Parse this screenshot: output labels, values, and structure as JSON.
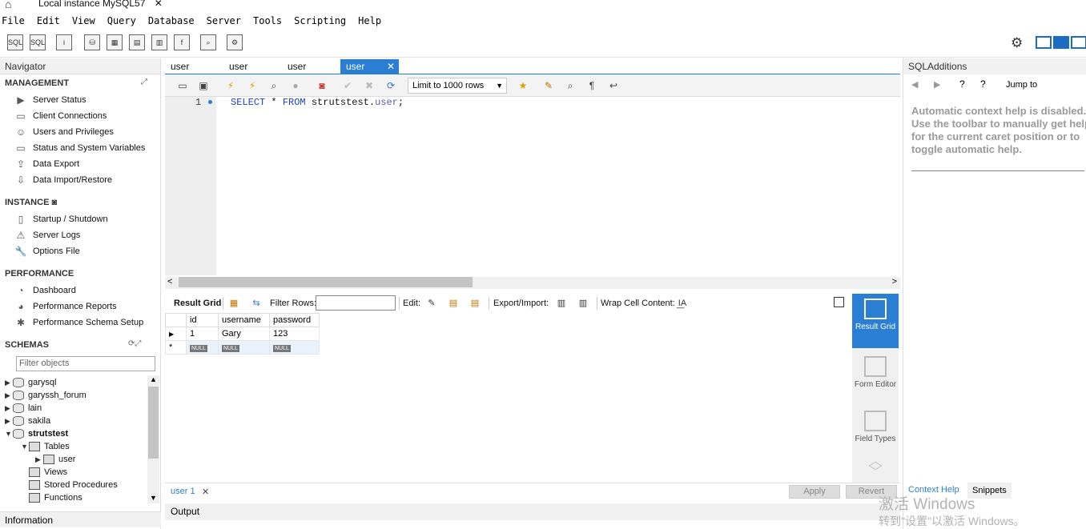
{
  "window": {
    "tab_title": "Local instance MySQL57",
    "tab_close": "✕",
    "home_icon": "home-icon"
  },
  "menu": [
    "File",
    "Edit",
    "View",
    "Query",
    "Database",
    "Server",
    "Tools",
    "Scripting",
    "Help"
  ],
  "navigator": {
    "title": "Navigator",
    "management_header": "MANAGEMENT",
    "management": [
      "Server Status",
      "Client Connections",
      "Users and Privileges",
      "Status and System Variables",
      "Data Export",
      "Data Import/Restore"
    ],
    "instance_header": "INSTANCE",
    "instance": [
      "Startup / Shutdown",
      "Server Logs",
      "Options File"
    ],
    "performance_header": "PERFORMANCE",
    "performance": [
      "Dashboard",
      "Performance Reports",
      "Performance Schema Setup"
    ],
    "schemas_header": "SCHEMAS",
    "filter_placeholder": "Filter objects",
    "schemas": [
      "garysql",
      "garyssh_forum",
      "lain",
      "sakila",
      "strutstest"
    ],
    "tree": {
      "tables": "Tables",
      "table_user": "user",
      "views": "Views",
      "procedures": "Stored Procedures",
      "functions": "Functions"
    },
    "information": "Information"
  },
  "query_tabs": [
    "user",
    "user",
    "user",
    "user"
  ],
  "query_toolbar": {
    "limit": "Limit to 1000 rows"
  },
  "editor": {
    "line_no": "1",
    "sql_select": "SELECT",
    "sql_star": " * ",
    "sql_from": "FROM",
    "sql_schema": " strutstest.",
    "sql_table": "user",
    "sql_end": ";"
  },
  "result_toolbar": {
    "result_grid": "Result Grid",
    "filter_rows": "Filter Rows:",
    "edit": "Edit:",
    "export": "Export/Import:",
    "wrap": "Wrap Cell Content:",
    "wrap_icon": "I͟A"
  },
  "grid": {
    "columns": [
      "id",
      "username",
      "password"
    ],
    "row1": [
      "1",
      "Gary",
      "123"
    ],
    "null_label": "NULL",
    "row_marker": "▶",
    "new_marker": "*"
  },
  "right_panel": {
    "result_grid": "Result Grid",
    "form_editor": "Form Editor",
    "field_types": "Field Types"
  },
  "bottom": {
    "result_tab": "user 1",
    "apply": "Apply",
    "revert": "Revert",
    "output": "Output"
  },
  "sql_additions": {
    "title": "SQLAdditions",
    "jump_to": "Jump to",
    "help_text": "Automatic context help is disabled. Use the toolbar to manually get help for the current caret position or to toggle automatic help.",
    "tab_context": "Context Help",
    "tab_snippets": "Snippets"
  },
  "watermark": {
    "line1": "激活 Windows",
    "line2": "转到\"设置\"以激活 Windows。"
  },
  "colors": {
    "accent": "#2a7fd4",
    "panel": "#f1f1f1"
  }
}
